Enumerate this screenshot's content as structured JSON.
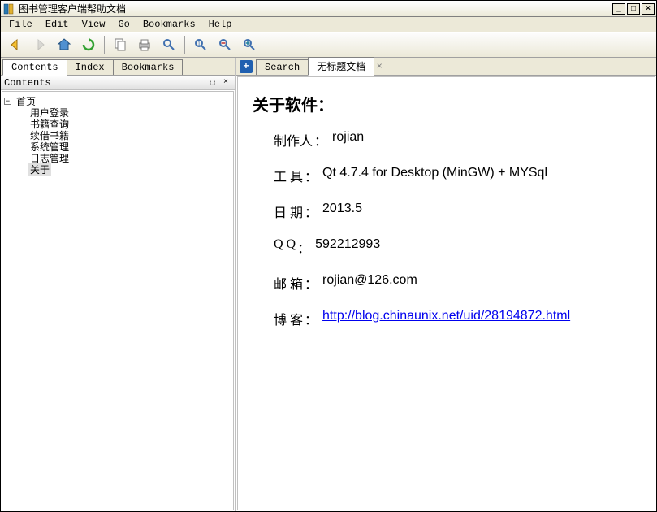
{
  "window": {
    "title": "图书管理客户端帮助文档",
    "min": "_",
    "max": "□",
    "close": "×"
  },
  "menu": {
    "file": "File",
    "edit": "Edit",
    "view": "View",
    "go": "Go",
    "bookmarks": "Bookmarks",
    "help": "Help"
  },
  "left": {
    "tabs": {
      "contents": "Contents",
      "index": "Index",
      "bookmarks": "Bookmarks"
    },
    "header": "Contents",
    "dock": "⬚",
    "close": "×",
    "tree": {
      "root": "首页",
      "children": [
        "用户登录",
        "书籍查询",
        "续借书籍",
        "系统管理",
        "日志管理",
        "关于"
      ]
    }
  },
  "right": {
    "tabs": {
      "search": "Search",
      "untitled": "无标题文档"
    },
    "plus": "+",
    "close": "×"
  },
  "content": {
    "heading": "关于软件：",
    "rows": [
      {
        "label": "制作人",
        "sep": "：",
        "value": "rojian"
      },
      {
        "label": "工 具",
        "sep": "：",
        "value": "Qt 4.7.4 for Desktop (MinGW) + MYSql"
      },
      {
        "label": "日 期",
        "sep": "：",
        "value": "2013.5"
      },
      {
        "label": "Q Q ",
        "sep": " ：",
        "value": "592212993"
      },
      {
        "label": "邮 箱",
        "sep": "：",
        "value": "rojian@126.com"
      },
      {
        "label": "博 客",
        "sep": "：",
        "value": "http://blog.chinaunix.net/uid/28194872.html",
        "link": true
      }
    ]
  }
}
